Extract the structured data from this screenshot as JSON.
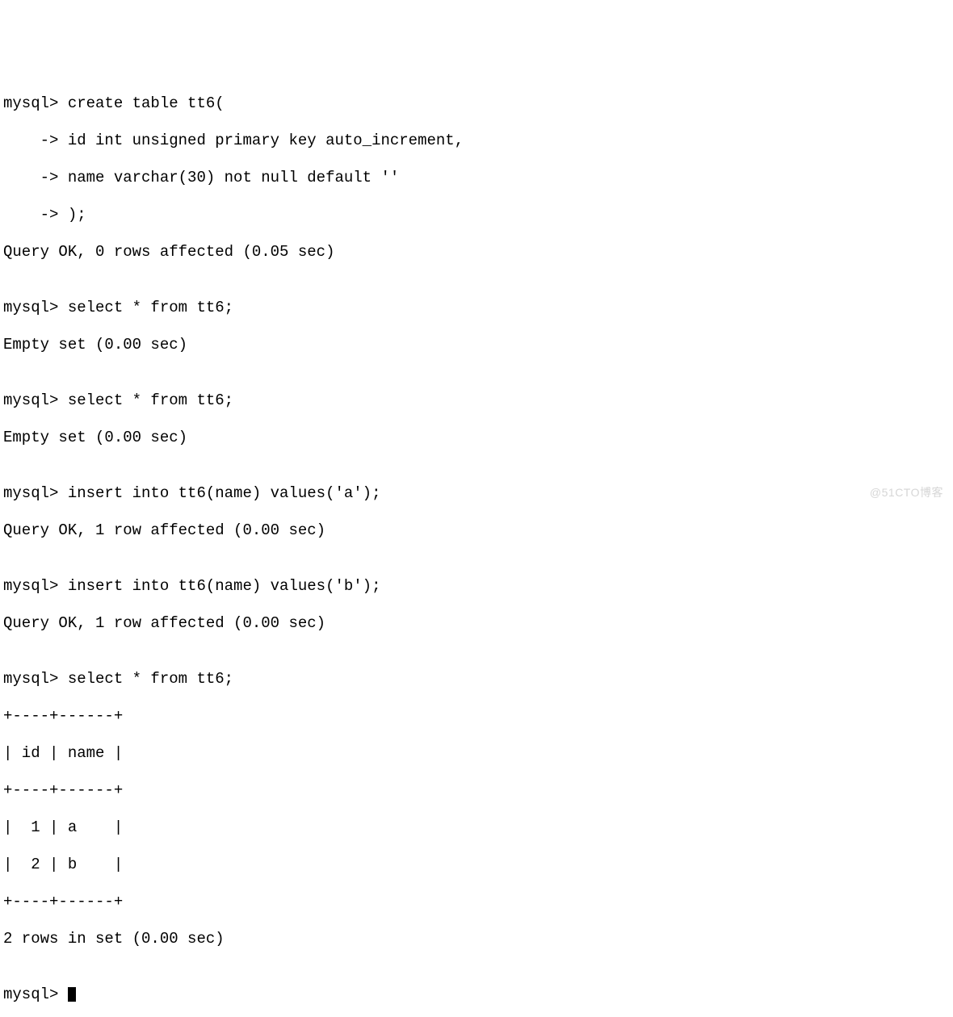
{
  "prompt": "mysql>",
  "cont": "    ->",
  "lines": {
    "l0": "mysql> create table tt6(",
    "l1": "    -> id int unsigned primary key auto_increment,",
    "l2": "    -> name varchar(30) not null default ''",
    "l3": "    -> );",
    "l4": "Query OK, 0 rows affected (0.05 sec)",
    "l5": "",
    "l6": "mysql> select * from tt6;",
    "l7": "Empty set (0.00 sec)",
    "l8": "",
    "l9": "mysql> select * from tt6;",
    "l10": "Empty set (0.00 sec)",
    "l11": "",
    "l12": "mysql> insert into tt6(name) values('a');",
    "l13": "Query OK, 1 row affected (0.00 sec)",
    "l14": "",
    "l15": "mysql> insert into tt6(name) values('b');",
    "l16": "Query OK, 1 row affected (0.00 sec)",
    "l17": "",
    "l18": "mysql> select * from tt6;",
    "l19": "+----+------+",
    "l20": "| id | name |",
    "l21": "+----+------+",
    "l22": "|  1 | a    |",
    "l23": "|  2 | b    |",
    "l24": "+----+------+",
    "l25": "2 rows in set (0.00 sec)",
    "l26": "",
    "l27": "mysql> "
  },
  "table": {
    "columns": [
      "id",
      "name"
    ],
    "rows": [
      {
        "id": 1,
        "name": "a"
      },
      {
        "id": 2,
        "name": "b"
      }
    ],
    "row_count": 2,
    "time_sec": "0.00"
  },
  "commands": {
    "create": "create table tt6( id int unsigned primary key auto_increment, name varchar(30) not null default '' );",
    "select": "select * from tt6;",
    "insert_a": "insert into tt6(name) values('a');",
    "insert_b": "insert into tt6(name) values('b');"
  },
  "results": {
    "create_ok": "Query OK, 0 rows affected (0.05 sec)",
    "empty": "Empty set (0.00 sec)",
    "insert_ok": "Query OK, 1 row affected (0.00 sec)",
    "select_summary": "2 rows in set (0.00 sec)"
  },
  "watermark": "@51CTO博客"
}
